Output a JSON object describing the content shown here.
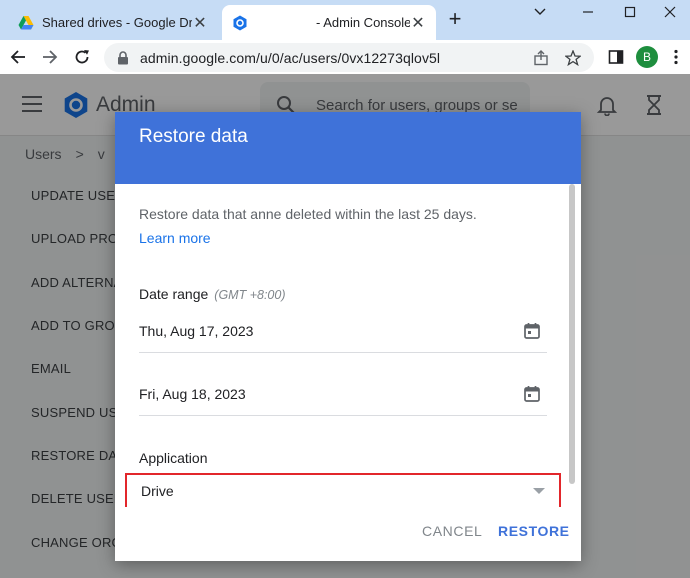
{
  "browser": {
    "tabs": [
      {
        "title": "Shared drives - Google Drive",
        "active": false
      },
      {
        "title": "- Admin Console",
        "active": true
      }
    ],
    "url": "admin.google.com/u/0/ac/users/0vx12273qlov5l",
    "profile_initial": "B"
  },
  "app": {
    "brand": "Admin",
    "search_placeholder": "Search for users, groups or se",
    "breadcrumb": [
      "Users",
      ">",
      "v"
    ]
  },
  "sidenav": {
    "items": [
      "UPDATE USER",
      "UPLOAD PROFILE",
      "ADD ALTERNATE",
      "ADD TO GROUPS",
      "EMAIL",
      "SUSPEND USER",
      "RESTORE DATA",
      "DELETE USER",
      "CHANGE ORG"
    ]
  },
  "dialog": {
    "title": "Restore data",
    "description": "Restore data that anne deleted within the last 25 days.",
    "learn_more": "Learn more",
    "date_range_label": "Date range",
    "timezone": "(GMT +8:00)",
    "start_date": "Thu, Aug 17, 2023",
    "end_date": "Fri, Aug 18, 2023",
    "application_label": "Application",
    "application_value": "Drive",
    "cancel": "CANCEL",
    "restore": "RESTORE"
  },
  "colors": {
    "dialog_header": "#3f72d9",
    "highlight_box": "#e2262b",
    "tabstrip": "#c6dcf5"
  }
}
